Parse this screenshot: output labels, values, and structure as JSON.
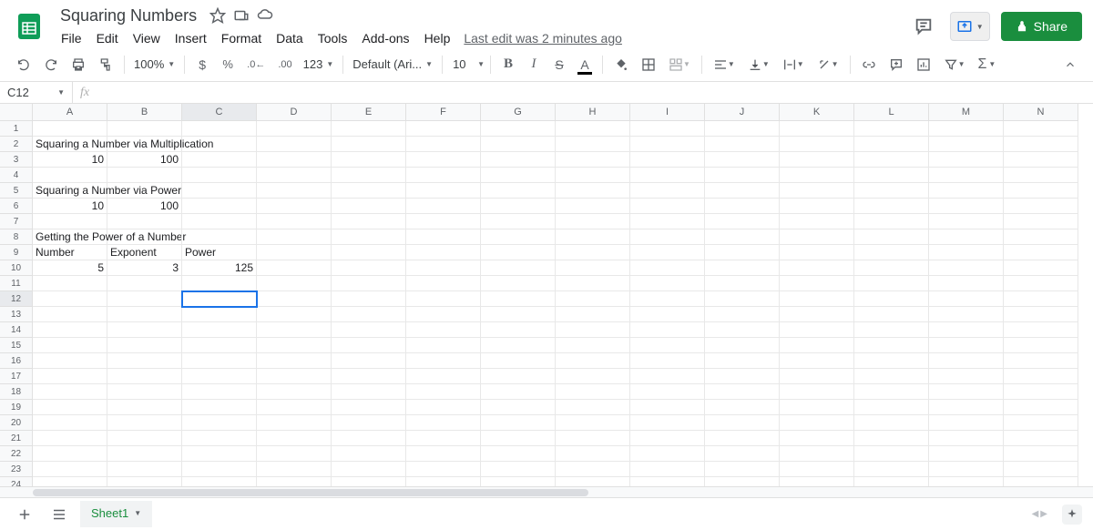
{
  "header": {
    "title": "Squaring Numbers",
    "menus": [
      "File",
      "Edit",
      "View",
      "Insert",
      "Format",
      "Data",
      "Tools",
      "Add-ons",
      "Help"
    ],
    "last_edit": "Last edit was 2 minutes ago",
    "share_label": "Share"
  },
  "toolbar": {
    "zoom": "100%",
    "font": "Default (Ari...",
    "font_size": "10",
    "number_format": "123"
  },
  "formula_bar": {
    "name_box": "C12",
    "fx": "fx",
    "formula": ""
  },
  "grid": {
    "columns": [
      "A",
      "B",
      "C",
      "D",
      "E",
      "F",
      "G",
      "H",
      "I",
      "J",
      "K",
      "L",
      "M",
      "N"
    ],
    "rows": 25,
    "selected_cell": {
      "row": 12,
      "col": 3
    },
    "cells": {
      "A2": {
        "v": "Squaring a Number via Multiplication",
        "t": "text"
      },
      "A3": {
        "v": "10",
        "t": "num"
      },
      "B3": {
        "v": "100",
        "t": "num"
      },
      "A5": {
        "v": "Squaring a Number via Power",
        "t": "text"
      },
      "A6": {
        "v": "10",
        "t": "num"
      },
      "B6": {
        "v": "100",
        "t": "num"
      },
      "A8": {
        "v": "Getting the Power of a Number",
        "t": "text"
      },
      "A9": {
        "v": "Number",
        "t": "text"
      },
      "B9": {
        "v": "Exponent",
        "t": "text"
      },
      "C9": {
        "v": "Power",
        "t": "text"
      },
      "A10": {
        "v": "5",
        "t": "num"
      },
      "B10": {
        "v": "3",
        "t": "num"
      },
      "C10": {
        "v": "125",
        "t": "num"
      }
    }
  },
  "sheets": {
    "active": "Sheet1"
  }
}
